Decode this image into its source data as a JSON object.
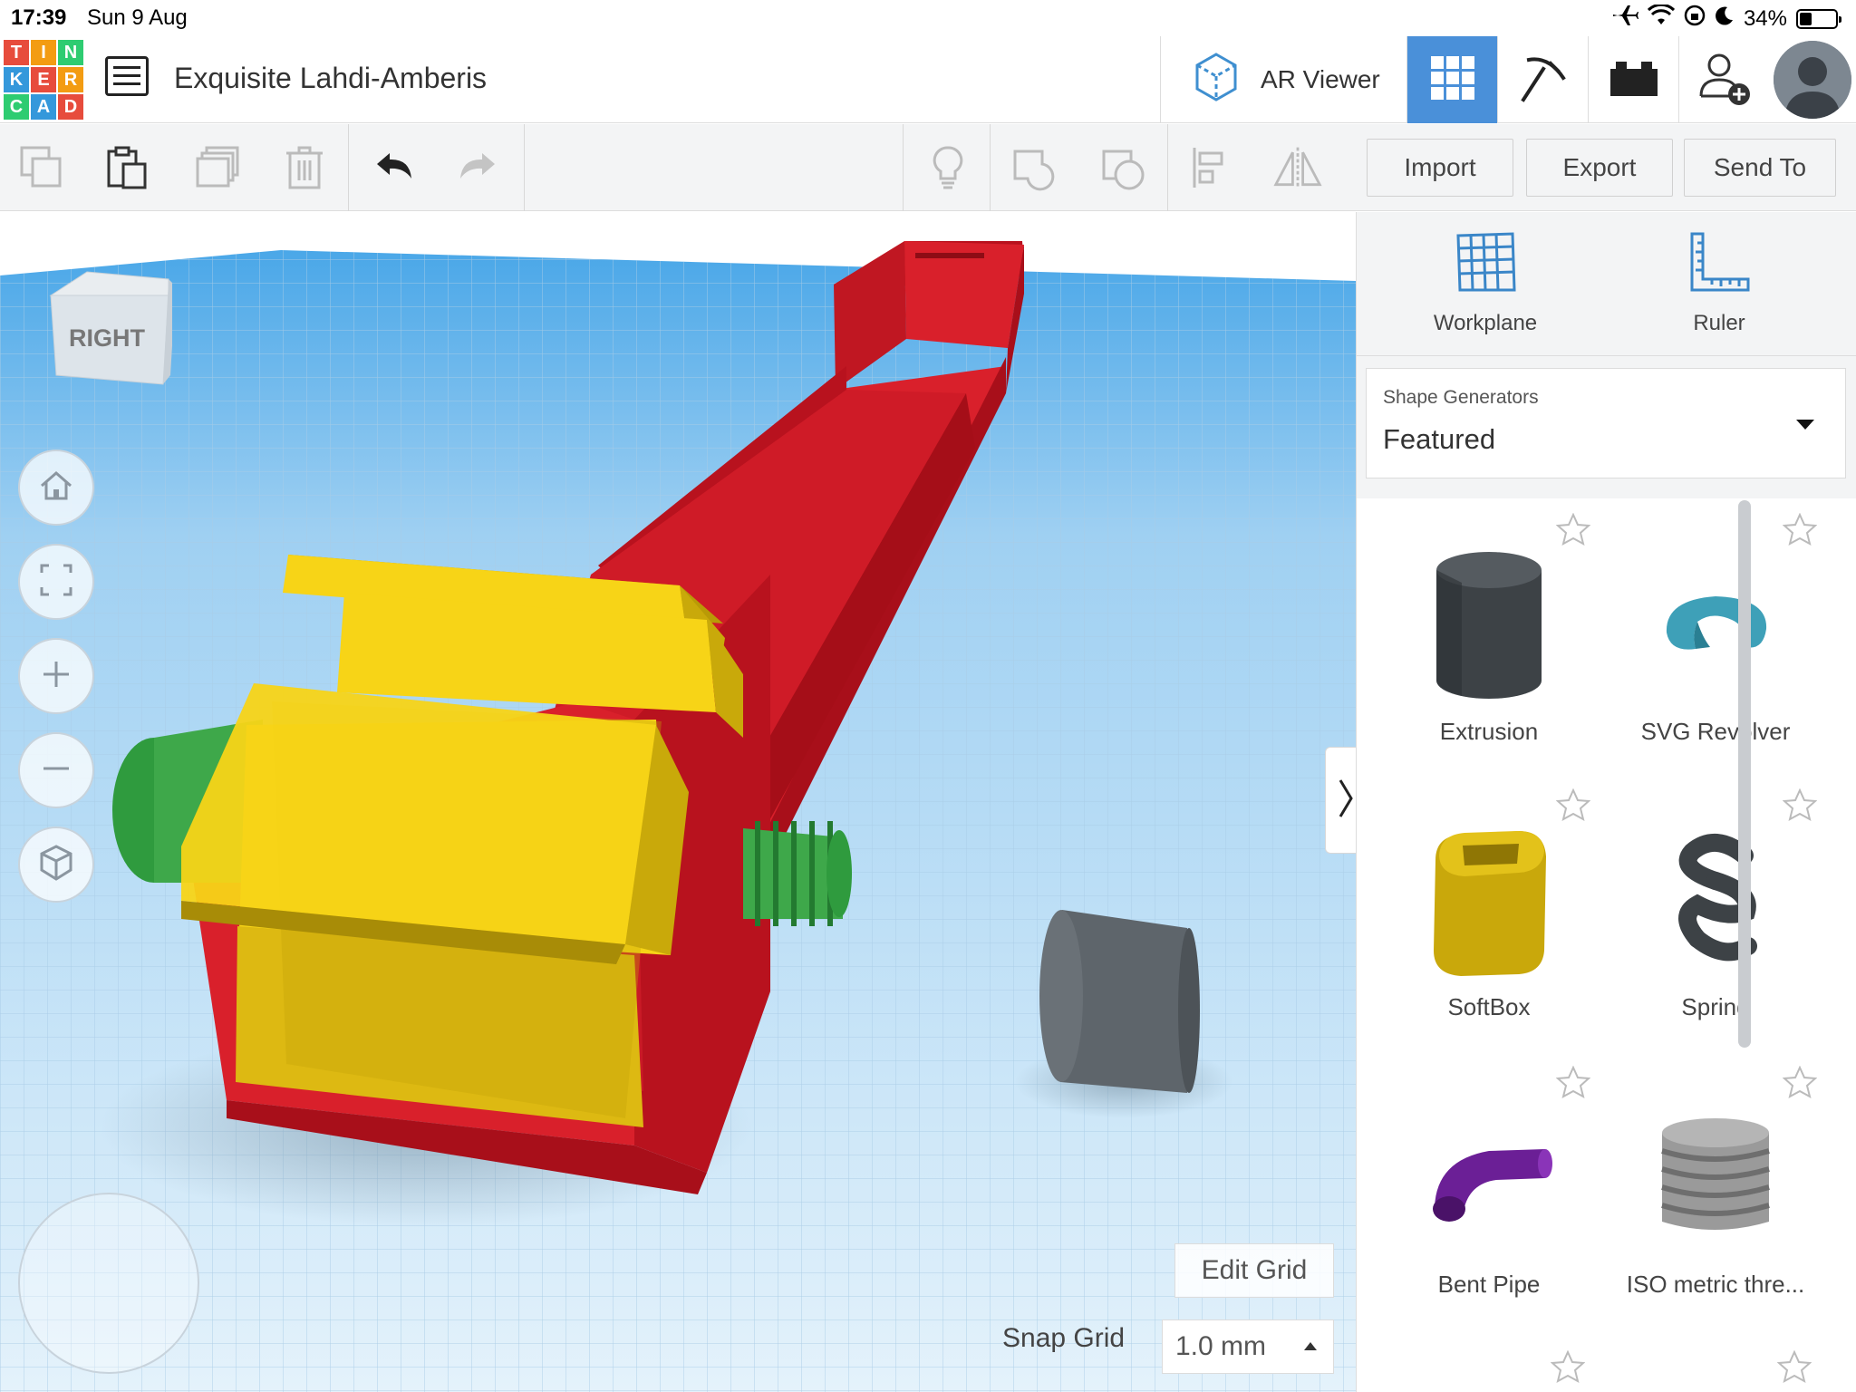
{
  "status_bar": {
    "time": "17:39",
    "date": "Sun 9 Aug",
    "battery": "34%",
    "battery_level": 0.34
  },
  "header": {
    "logo_letters": [
      "T",
      "I",
      "N",
      "K",
      "E",
      "R",
      "C",
      "A",
      "D"
    ],
    "logo_colors": [
      "#e74c3c",
      "#f39c12",
      "#2ecc71",
      "#3498db",
      "#e74c3c",
      "#f39c12",
      "#2ecc71",
      "#3498db",
      "#e74c3c"
    ],
    "project_title": "Exquisite Lahdi-Amberis",
    "ar_viewer_label": "AR Viewer",
    "active_view_color": "#4a90d9"
  },
  "toolbar": {
    "import_label": "Import",
    "export_label": "Export",
    "send_to_label": "Send To"
  },
  "viewport": {
    "view_cube_label": "RIGHT",
    "edit_grid_label": "Edit Grid",
    "snap_grid_label": "Snap Grid",
    "snap_grid_value": "1.0 mm"
  },
  "panel": {
    "workplane_label": "Workplane",
    "ruler_label": "Ruler",
    "category_label": "Shape Generators",
    "category_value": "Featured",
    "shapes": [
      {
        "name": "Extrusion",
        "icon": "cylinder-icon"
      },
      {
        "name": "SVG Revolver",
        "icon": "torus-icon"
      },
      {
        "name": "SoftBox",
        "icon": "softbox-icon"
      },
      {
        "name": "Spring",
        "icon": "spring-icon"
      },
      {
        "name": "Bent Pipe",
        "icon": "bent-pipe-icon"
      },
      {
        "name": "ISO metric thre...",
        "icon": "thread-icon"
      }
    ]
  },
  "colors": {
    "workplane_blue": "#cfe6f5",
    "part_red": "#d9202b",
    "part_yellow": "#f7d417",
    "part_green": "#3ea84a",
    "part_grey": "#5e656b"
  }
}
